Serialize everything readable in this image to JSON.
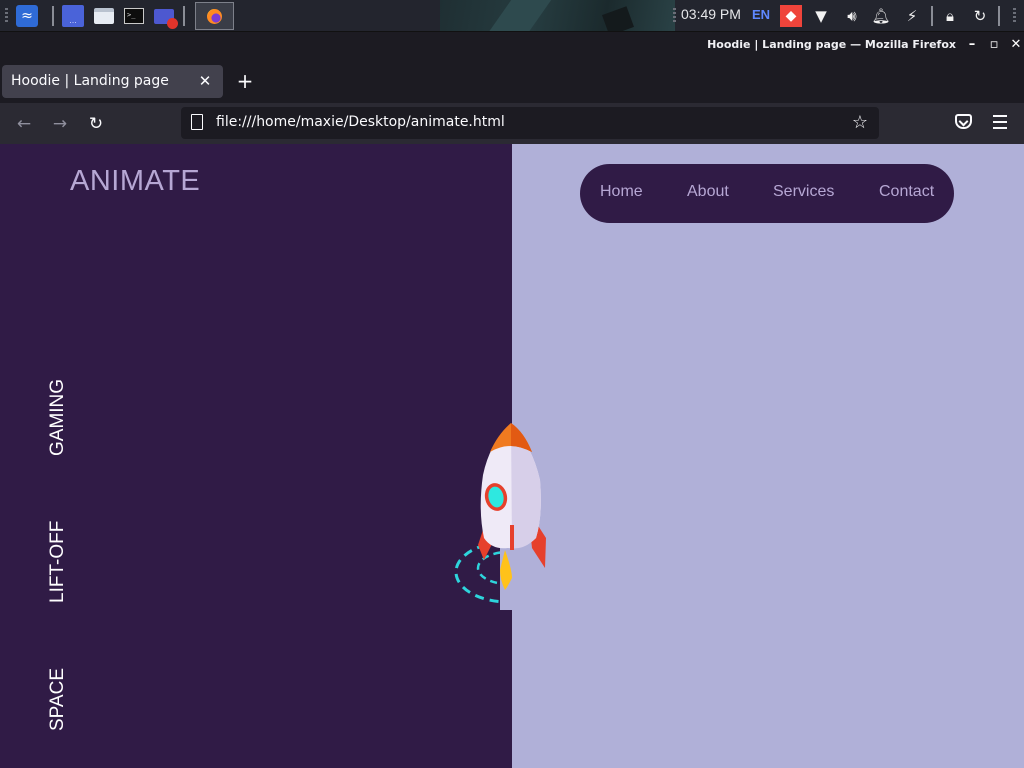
{
  "os_panel": {
    "clock": "03:49 PM",
    "language": "EN",
    "launchers": [
      "kali-menu-icon",
      "workspace-icon",
      "file-manager-icon",
      "terminal-icon",
      "screen-recorder-icon"
    ],
    "tray": [
      "anydesk-icon",
      "wifi-icon",
      "volume-icon",
      "notifications-icon",
      "power-icon",
      "lock-icon",
      "logout-icon"
    ]
  },
  "window": {
    "title": "Hoodie | Landing page — Mozilla Firefox",
    "controls": {
      "minimize": "–",
      "maximize": "▫",
      "close": "✕"
    }
  },
  "browser": {
    "tab_title": "Hoodie | Landing page",
    "tab_close": "✕",
    "new_tab": "+",
    "back": "←",
    "forward": "→",
    "reload": "↻",
    "url": "file:///home/maxie/Desktop/animate.html",
    "bookmark": "☆"
  },
  "page": {
    "brand": "ANIMATE",
    "nav": [
      "Home",
      "About",
      "Services",
      "Contact"
    ],
    "side_words": [
      "GAMING",
      "LIFT-OFF",
      "SPACE"
    ],
    "colors": {
      "left_bg": "#301b46",
      "right_bg": "#b0b0d8",
      "brand_text": "#b6a7d4",
      "rocket_window": "#2ee8e0",
      "rocket_fins": "#e6402c",
      "rocket_tip": "#f07a20",
      "orbit": "#2ed5dc"
    }
  }
}
